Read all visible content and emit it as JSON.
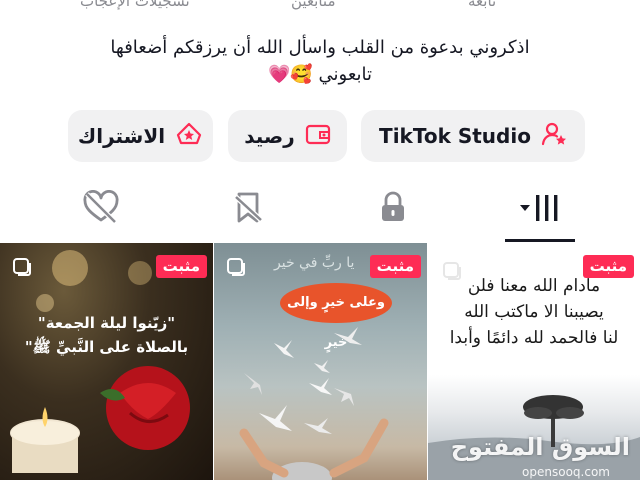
{
  "stats": {
    "likes_label": "تسجيلات الإعجاب",
    "followers_label": "متابعين",
    "following_label": "تابعه"
  },
  "bio": {
    "line1": "اذكروني بدعوة من القلب واسأل الله أن يرزقكم أضعافها",
    "line2": "تابعوني 🥰💗"
  },
  "actions": {
    "studio_label": "TikTok Studio",
    "balance_label": "رصيد",
    "subscription_label": "الاشتراك"
  },
  "tabs": [
    {
      "name": "videos",
      "icon": "grid-bars-icon",
      "active": true
    },
    {
      "name": "private",
      "icon": "lock-icon"
    },
    {
      "name": "favorites",
      "icon": "bookmark-icon"
    },
    {
      "name": "liked",
      "icon": "hidden-heart-icon"
    }
  ],
  "videos": [
    {
      "pinned_label": "مثبت",
      "text_lines": [
        "مادام الله معنا فلن",
        "يصيبنا الا ماكتب الله",
        "لنا فالحمد لله دائمًا وأبدا"
      ],
      "watermark": "السوق المفتوح",
      "watermark_sub": "opensooq.com"
    },
    {
      "pinned_label": "مثبت",
      "text_top": "يا ربِّ في خير",
      "text_bubble": "وعلى خيرٍ وإلى خيرٍ"
    },
    {
      "pinned_label": "مثبت",
      "text_line1": "\"زيّنوا ليلة الجمعة\"",
      "text_line2": "بالصلاة على النَّبيِّ ﷺ\""
    }
  ],
  "colors": {
    "accent": "#fe2c55",
    "button_bg": "#f1f1f2",
    "text": "#161823",
    "muted": "#8a8b91"
  }
}
